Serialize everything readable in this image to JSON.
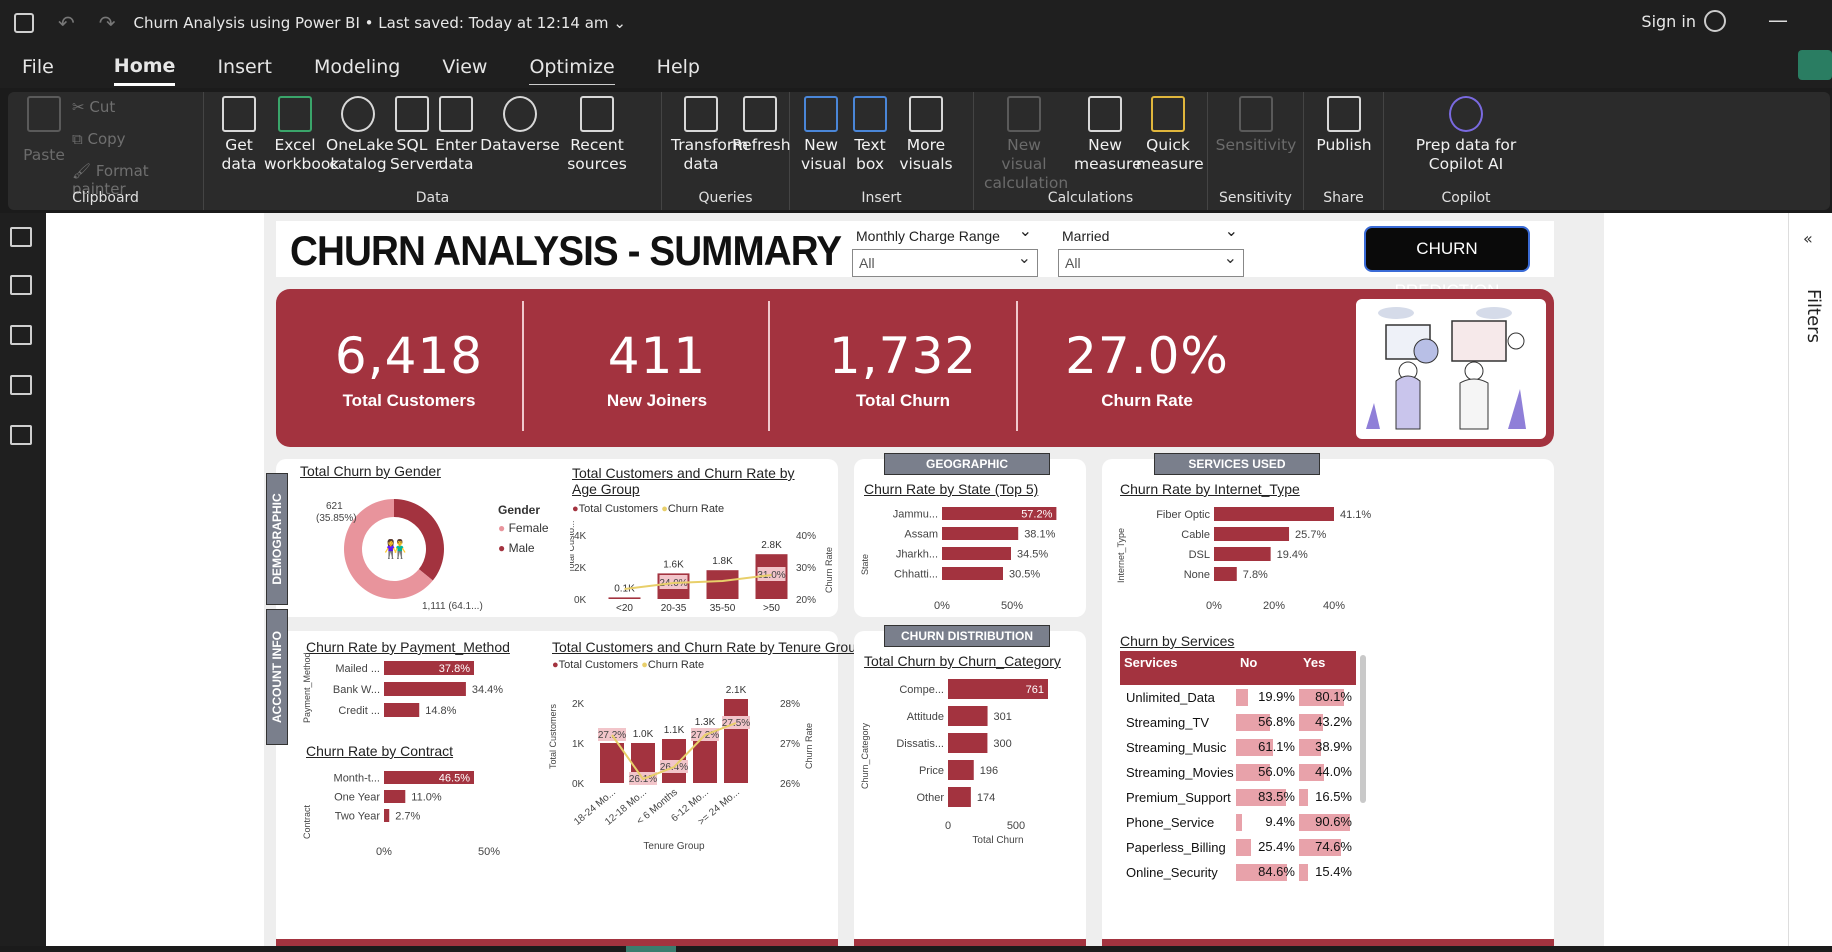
{
  "app": {
    "window_title": "Churn Analysis using Power BI",
    "saved_status": "Last saved: Today at 12:14 am",
    "sign_in": "Sign in"
  },
  "menu": [
    "File",
    "Home",
    "Insert",
    "Modeling",
    "View",
    "Optimize",
    "Help"
  ],
  "ribbon": {
    "clipboard": {
      "paste": "Paste",
      "cut": "Cut",
      "copy": "Copy",
      "format_painter": "Format painter",
      "group": "Clipboard"
    },
    "data": {
      "get_data": "Get data",
      "excel": "Excel workbook",
      "onelake": "OneLake catalog",
      "sql": "SQL Server",
      "enter_data": "Enter data",
      "dataverse": "Dataverse",
      "recent": "Recent sources",
      "group": "Data"
    },
    "queries": {
      "transform": "Transform data",
      "refresh": "Refresh",
      "group": "Queries"
    },
    "insert": {
      "new_visual": "New visual",
      "text_box": "Text box",
      "more_visuals": "More visuals",
      "group": "Insert"
    },
    "calculations": {
      "new_visual_calc": "New visual calculation",
      "new_measure": "New measure",
      "quick_measure": "Quick measure",
      "group": "Calculations"
    },
    "sensitivity": {
      "label": "Sensitivity",
      "group": "Sensitivity"
    },
    "share": {
      "publish": "Publish",
      "group": "Share"
    },
    "copilot": {
      "prep": "Prep data for Copilot AI",
      "group": "Copilot"
    }
  },
  "filters_pane": "Filters",
  "report": {
    "title": "CHURN ANALYSIS - SUMMARY",
    "slicer_charge": {
      "title": "Monthly Charge Range",
      "value": "All"
    },
    "slicer_married": {
      "title": "Married",
      "value": "All"
    },
    "prediction_button": "CHURN PREDICTION",
    "kpis": [
      {
        "value": "6,418",
        "label": "Total Customers"
      },
      {
        "value": "411",
        "label": "New Joiners"
      },
      {
        "value": "1,732",
        "label": "Total Churn"
      },
      {
        "value": "27.0%",
        "label": "Churn Rate"
      }
    ],
    "sections": {
      "demographic": "DEMOGRAPHIC",
      "account": "ACCOUNT INFO",
      "geographic": "GEOGRAPHIC",
      "services": "SERVICES USED",
      "churn_dist": "CHURN DISTRIBUTION"
    },
    "colors": {
      "maroon": "#a3333f",
      "pink": "#e8949c",
      "gold": "#e8cf6a"
    }
  },
  "chart_data": [
    {
      "id": "gender",
      "type": "pie",
      "title": "Total Churn by Gender",
      "legend_title": "Gender",
      "categories": [
        "Female",
        "Male"
      ],
      "values": [
        1111,
        621
      ],
      "data_labels": [
        "1,111 (64.1...)",
        "621 (35.85%)"
      ]
    },
    {
      "id": "age",
      "type": "bar",
      "title": "Total Customers and Churn Rate by Age Group",
      "legend": [
        "Total Customers",
        "Churn Rate"
      ],
      "categories": [
        "<20",
        "20-35",
        "35-50",
        ">50"
      ],
      "series": [
        {
          "name": "Total Customers",
          "values": [
            100,
            1600,
            1800,
            2800
          ],
          "labels": [
            "0.1K",
            "1.6K",
            "1.8K",
            "2.8K"
          ]
        },
        {
          "name": "Churn Rate",
          "values": [
            null,
            24.0,
            null,
            31.0
          ],
          "labels": [
            "",
            "24.0%",
            "",
            "31.0%"
          ]
        }
      ],
      "ylabel": "Total Custo...",
      "y2label": "Churn Rate",
      "yticks": [
        "0K",
        "2K",
        "4K"
      ],
      "y2ticks": [
        "20%",
        "30%",
        "40%"
      ]
    },
    {
      "id": "state",
      "type": "bar",
      "title": "Churn Rate by State (Top 5)",
      "ylabel": "State",
      "categories": [
        "Jammu...",
        "Assam",
        "Jharkh...",
        "Chhatti..."
      ],
      "values": [
        57.2,
        38.1,
        34.5,
        30.5
      ],
      "labels": [
        "57.2%",
        "38.1%",
        "34.5%",
        "30.5%"
      ],
      "xticks": [
        "0%",
        "50%"
      ]
    },
    {
      "id": "internet",
      "type": "bar",
      "title": "Churn Rate by Internet_Type",
      "ylabel": "Internet_Type",
      "categories": [
        "Fiber Optic",
        "Cable",
        "DSL",
        "None"
      ],
      "values": [
        41.1,
        25.7,
        19.4,
        7.8
      ],
      "labels": [
        "41.1%",
        "25.7%",
        "19.4%",
        "7.8%"
      ],
      "xticks": [
        "0%",
        "20%",
        "40%"
      ]
    },
    {
      "id": "payment",
      "type": "bar",
      "title": "Churn Rate by Payment_Method",
      "ylabel": "Payment_Method",
      "categories": [
        "Mailed ...",
        "Bank W...",
        "Credit ..."
      ],
      "values": [
        37.8,
        34.4,
        14.8
      ],
      "labels": [
        "37.8%",
        "34.4%",
        "14.8%"
      ]
    },
    {
      "id": "contract",
      "type": "bar",
      "title": "Churn Rate by Contract",
      "ylabel": "Contract",
      "categories": [
        "Month-t...",
        "One Year",
        "Two Year"
      ],
      "values": [
        46.5,
        11.0,
        2.7
      ],
      "labels": [
        "46.5%",
        "11.0%",
        "2.7%"
      ],
      "xticks": [
        "0%",
        "50%"
      ]
    },
    {
      "id": "tenure",
      "type": "bar",
      "title": "Total Customers and Churn Rate by Tenure Group",
      "legend": [
        "Total Customers",
        "Churn Rate"
      ],
      "xlabel": "Tenure Group",
      "ylabel": "Total Customers",
      "y2label": "Churn Rate",
      "categories": [
        "18-24 Mo...",
        "12-18 Mo...",
        "< 6 Months",
        "6-12 Mo...",
        ">= 24 Mo..."
      ],
      "series": [
        {
          "name": "Total Customers",
          "values": [
            1000,
            1000,
            1100,
            1300,
            2100
          ],
          "labels": [
            "1.0K",
            "1.0K",
            "1.1K",
            "1.3K",
            "2.1K"
          ]
        },
        {
          "name": "Churn Rate",
          "values": [
            27.2,
            26.1,
            26.4,
            27.2,
            27.5
          ],
          "labels": [
            "27.2%",
            "26.1%",
            "26.4%",
            "27.2%",
            "27.5%"
          ]
        }
      ],
      "yticks": [
        "0K",
        "1K",
        "2K"
      ],
      "y2ticks": [
        "26%",
        "27%",
        "28%"
      ]
    },
    {
      "id": "category",
      "type": "bar",
      "title": "Total Churn by Churn_Category",
      "ylabel": "Churn_Category",
      "xlabel": "Total Churn",
      "categories": [
        "Compe...",
        "Attitude",
        "Dissatis...",
        "Price",
        "Other"
      ],
      "values": [
        761,
        301,
        300,
        196,
        174
      ],
      "xticks": [
        "0",
        "500"
      ]
    },
    {
      "id": "services",
      "type": "table",
      "title": "Churn by Services",
      "columns": [
        "Services",
        "No",
        "Yes"
      ],
      "rows": [
        [
          "Unlimited_Data",
          "19.9%",
          "80.1%"
        ],
        [
          "Streaming_TV",
          "56.8%",
          "43.2%"
        ],
        [
          "Streaming_Music",
          "61.1%",
          "38.9%"
        ],
        [
          "Streaming_Movies",
          "56.0%",
          "44.0%"
        ],
        [
          "Premium_Support",
          "83.5%",
          "16.5%"
        ],
        [
          "Phone_Service",
          "9.4%",
          "90.6%"
        ],
        [
          "Paperless_Billing",
          "25.4%",
          "74.6%"
        ],
        [
          "Online_Security",
          "84.6%",
          "15.4%"
        ]
      ],
      "no_values": [
        19.9,
        56.8,
        61.1,
        56.0,
        83.5,
        9.4,
        25.4,
        84.6
      ],
      "yes_values": [
        80.1,
        43.2,
        38.9,
        44.0,
        16.5,
        90.6,
        74.6,
        15.4
      ]
    }
  ]
}
